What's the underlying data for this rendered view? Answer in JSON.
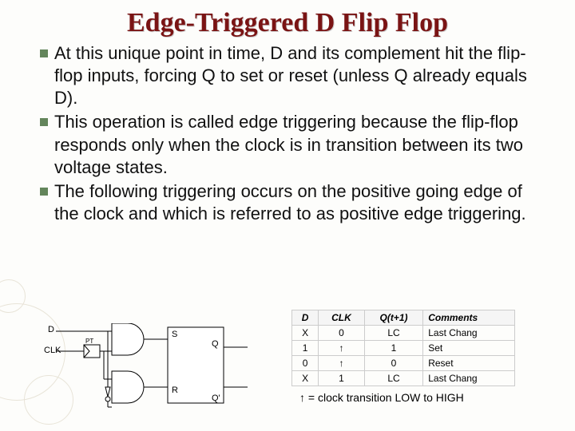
{
  "title": "Edge-Triggered D Flip Flop",
  "bullets": [
    "At this unique point in time, D and its complement hit the flip-flop inputs, forcing Q to set or reset (unless Q already equals D).",
    "This operation is called edge triggering because the flip-flop responds only when the clock is in transition  between its two voltage states.",
    "The following triggering occurs on the positive going edge of the clock and which is referred to as positive edge triggering."
  ],
  "diagram": {
    "D": "D",
    "CLK": "CLK",
    "PT": "PT",
    "S": "S",
    "R": "R",
    "Q": "Q",
    "Qp": "Q'"
  },
  "table": {
    "headers": [
      "D",
      "CLK",
      "Q(t+1)",
      "Comments"
    ],
    "rows": [
      [
        "X",
        "0",
        "LC",
        "Last Chang"
      ],
      [
        "1",
        "↑",
        "1",
        "Set"
      ],
      [
        "0",
        "↑",
        "0",
        "Reset"
      ],
      [
        "X",
        "1",
        "LC",
        "Last Chang"
      ]
    ]
  },
  "note": "↑ = clock transition LOW to HIGH"
}
